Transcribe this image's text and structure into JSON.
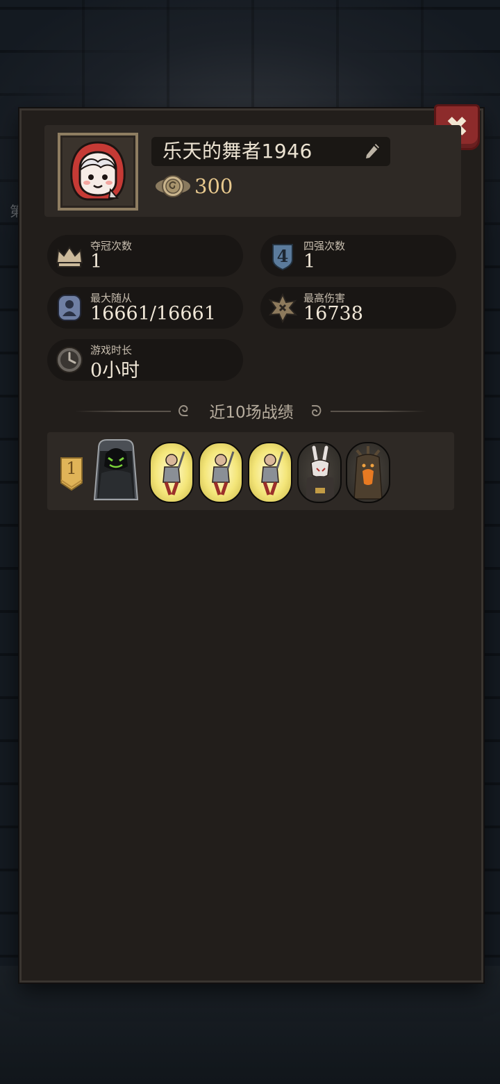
{
  "background": {
    "side_text": "第"
  },
  "profile": {
    "name": "乐天的舞者1946",
    "coins": "300",
    "avatar_icon": "red-hood-girl-avatar"
  },
  "stats": {
    "championships": {
      "label": "夺冠次数",
      "value": "1",
      "icon": "crown-icon"
    },
    "top_four": {
      "label": "四强次数",
      "value": "1",
      "icon": "four-shield-icon"
    },
    "max_followers": {
      "label": "最大随从",
      "value": "16661/16661",
      "icon": "follower-icon"
    },
    "max_damage": {
      "label": "最高伤害",
      "value": "16738",
      "icon": "damage-burst-icon"
    },
    "play_time": {
      "label": "游戏时长",
      "value": "0小时",
      "icon": "clock-icon"
    }
  },
  "recent": {
    "title": "近10场战绩",
    "matches": [
      {
        "rank": "1",
        "hero_icon": "shadow-demon-hero",
        "units": [
          "warrior-unit-golden",
          "warrior-unit-golden",
          "warrior-unit-golden",
          "rabbit-mask-unit",
          "treant-unit"
        ]
      }
    ]
  },
  "colors": {
    "panel": "#221e1b",
    "close_button": "#8d2b2b",
    "coin_text": "#e8c98e",
    "golden_frame": "#f4e67a"
  }
}
